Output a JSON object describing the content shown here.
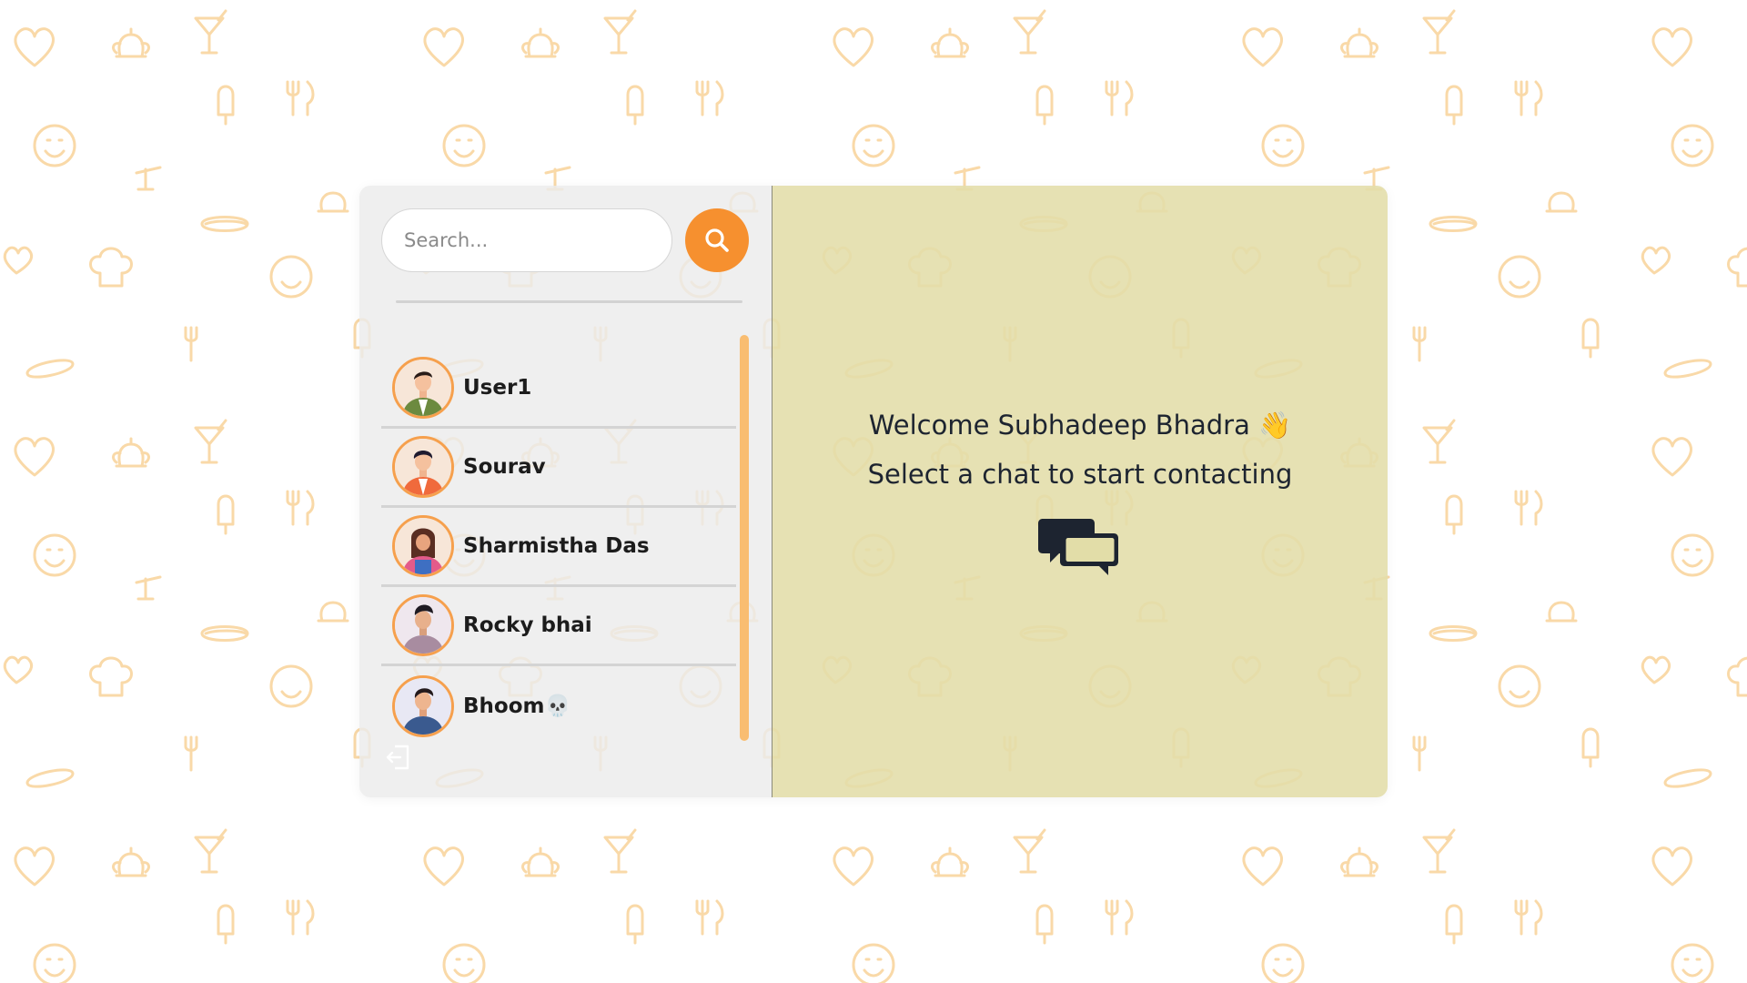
{
  "search": {
    "placeholder": "Search...",
    "value": "",
    "button_icon": "search-icon"
  },
  "contacts": [
    {
      "name": "User1",
      "avatar": "avatar-man-green-jacket"
    },
    {
      "name": "Sourav",
      "avatar": "avatar-man-orange-shirt"
    },
    {
      "name": "Sharmistha Das",
      "avatar": "avatar-woman-blue-apron"
    },
    {
      "name": "Rocky bhai",
      "avatar": "avatar-man-purple-shirt"
    },
    {
      "name": "Bhoom💀",
      "avatar": "avatar-man-blue-shirt"
    }
  ],
  "main": {
    "welcome_prefix": "Welcome Subhadeep Bhadra",
    "welcome_emoji": "👋",
    "subtitle": "Select a chat to start contacting",
    "icon": "chat-bubbles-icon"
  },
  "logout": {
    "icon": "logout-icon"
  },
  "colors": {
    "accent": "#f6902f",
    "pattern": "#f9d9a8",
    "sidebar_bg": "#ececec",
    "main_bg": "#e2dda8",
    "text": "#1d2430"
  }
}
